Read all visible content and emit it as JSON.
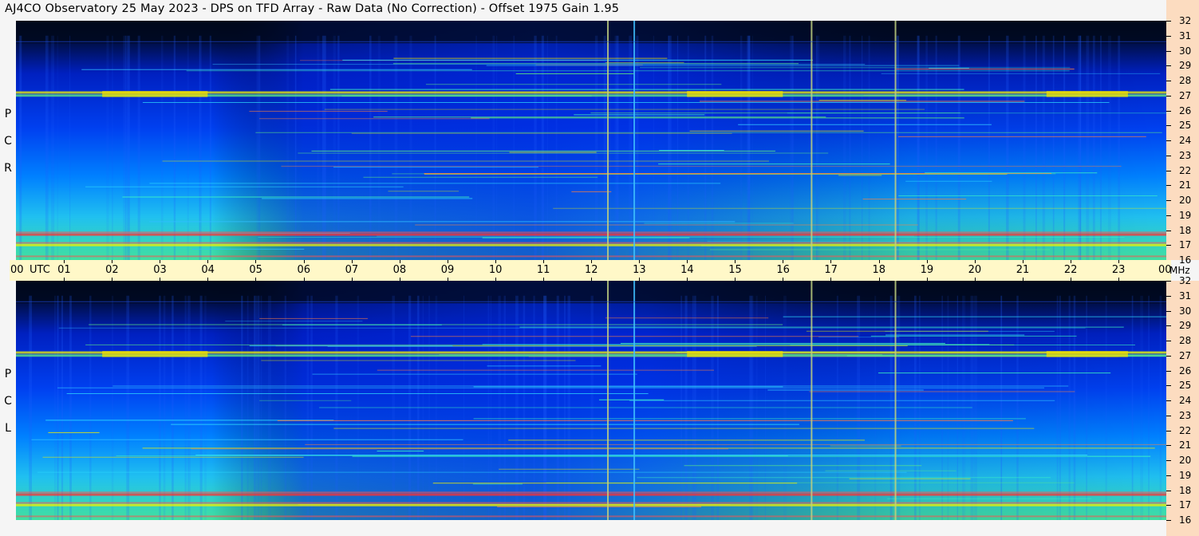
{
  "title": "AJ4CO Observatory  25 May 2023  -  DPS on TFD Array  -  Raw Data (No Correction)  -  Offset 1975  Gain 1.95",
  "chart_data": [
    {
      "type": "heatmap",
      "panel": "RCP",
      "polarization_label": [
        "R",
        "C",
        "P"
      ],
      "x_labels": [
        "00",
        "UTC",
        "01",
        "02",
        "03",
        "04",
        "05",
        "06",
        "07",
        "08",
        "09",
        "10",
        "11",
        "12",
        "13",
        "14",
        "15",
        "16",
        "17",
        "18",
        "19",
        "20",
        "21",
        "22",
        "23",
        "00"
      ],
      "xlim_hours_utc": [
        0,
        24
      ],
      "y_ticks": [
        16,
        17,
        18,
        19,
        20,
        21,
        22,
        23,
        24,
        25,
        26,
        27,
        28,
        29,
        30,
        31,
        32
      ],
      "ylim_mhz": [
        16,
        32
      ],
      "y_unit": "MHz",
      "colormap": "jet",
      "bright_bands_mhz": [
        17.0,
        17.7,
        27.0,
        27.2
      ],
      "vertical_lines_utc": [
        12.35,
        12.9,
        16.6,
        18.35
      ]
    },
    {
      "type": "heatmap",
      "panel": "LCP",
      "polarization_label": [
        "L",
        "C",
        "P"
      ],
      "x_labels": [
        "00",
        "UTC",
        "01",
        "02",
        "03",
        "04",
        "05",
        "06",
        "07",
        "08",
        "09",
        "10",
        "11",
        "12",
        "13",
        "14",
        "15",
        "16",
        "17",
        "18",
        "19",
        "20",
        "21",
        "22",
        "23",
        "00"
      ],
      "xlim_hours_utc": [
        0,
        24
      ],
      "y_ticks": [
        16,
        17,
        18,
        19,
        20,
        21,
        22,
        23,
        24,
        25,
        26,
        27,
        28,
        29,
        30,
        31,
        32
      ],
      "ylim_mhz": [
        16,
        32
      ],
      "y_unit": "MHz",
      "colormap": "jet",
      "bright_bands_mhz": [
        17.0,
        17.7,
        27.0,
        27.2
      ],
      "vertical_lines_utc": [
        12.35,
        12.9,
        16.6,
        18.35
      ]
    }
  ],
  "time_axis": {
    "labels": [
      "01",
      "02",
      "03",
      "04",
      "05",
      "06",
      "07",
      "08",
      "09",
      "10",
      "11",
      "12",
      "13",
      "14",
      "15",
      "16",
      "17",
      "18",
      "19",
      "20",
      "21",
      "22",
      "23"
    ],
    "start": "00",
    "utc": "UTC",
    "end": "00",
    "unit": "MHz"
  },
  "freq_axis": {
    "labels": [
      "32",
      "31",
      "30",
      "29",
      "28",
      "27",
      "26",
      "25",
      "24",
      "23",
      "22",
      "21",
      "20",
      "19",
      "18",
      "17",
      "16"
    ]
  },
  "colors": {
    "background": "#0a1a6a",
    "deep_blue": "#0030e0",
    "cyan": "#20c0ff",
    "green": "#60f080",
    "yellow": "#f0f000",
    "red": "#ff3030",
    "freq_strip": "#fcdcc0",
    "time_strip": "#fff8c8"
  }
}
